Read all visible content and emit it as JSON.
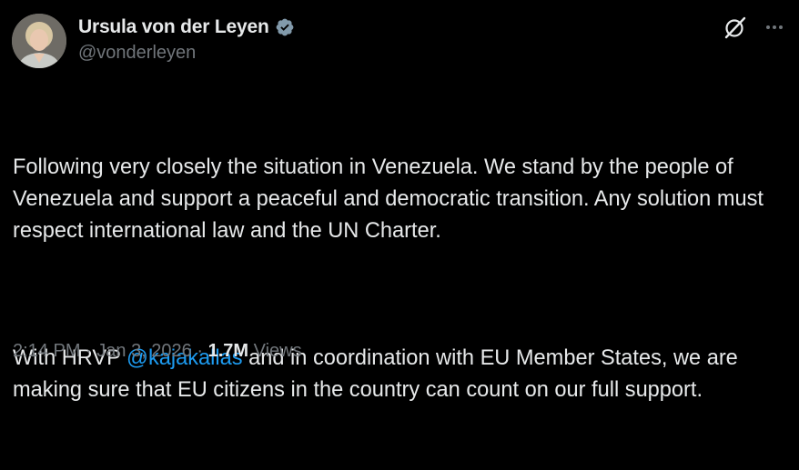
{
  "author": {
    "display_name": "Ursula von der Leyen",
    "handle": "@vonderleyen",
    "verified": true,
    "verified_badge_color": "#829aab"
  },
  "actions": {
    "grok_icon": "grok-icon",
    "more_icon": "more-horizontal-icon"
  },
  "tweet": {
    "paragraph1": "Following very closely the situation in Venezuela. We stand by the people of Venezuela and support a peaceful and democratic transition. Any solution must respect international law and the UN Charter.",
    "paragraph2_before": "With HRVP ",
    "mention": "@kajakallas",
    "paragraph2_after": " and in coordination with EU Member States, we are making sure that EU citizens in the country can count on our full support."
  },
  "meta": {
    "time": "2:14 PM",
    "separator1": " · ",
    "date": "Jan 3, 2026",
    "separator2": " · ",
    "views_count": "1.7M",
    "views_label": " Views"
  },
  "colors": {
    "background": "#000000",
    "text_primary": "#e7e9ea",
    "text_secondary": "#71767b",
    "link": "#1d9bf0"
  }
}
